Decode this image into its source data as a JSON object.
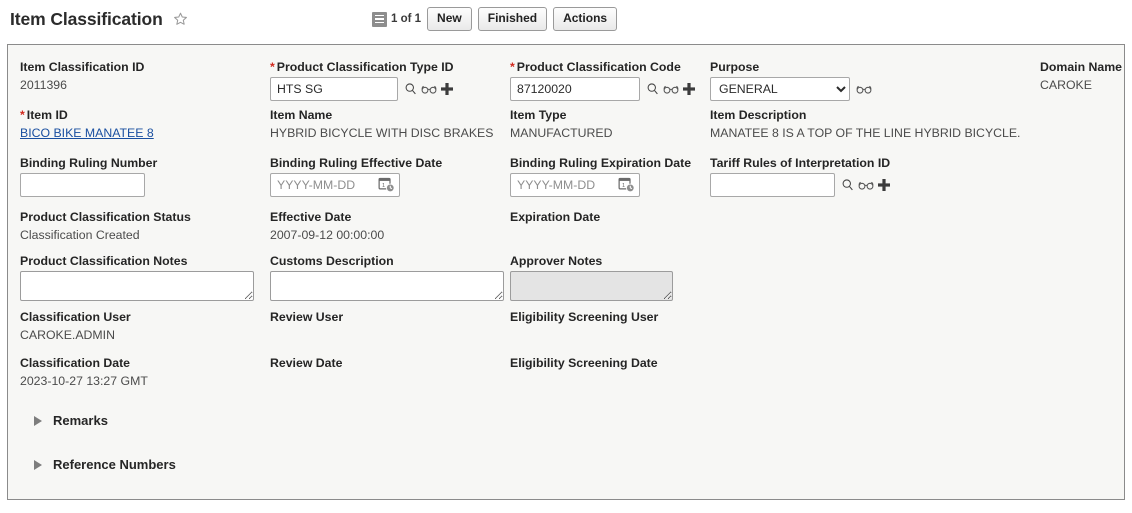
{
  "header": {
    "title": "Item Classification",
    "star_icon": "star-outline-icon",
    "list_icon": "list-view-icon",
    "page_count": "1 of 1",
    "buttons": [
      {
        "label": "New",
        "name": "new-button"
      },
      {
        "label": "Finished",
        "name": "finished-button"
      },
      {
        "label": "Actions",
        "name": "actions-button"
      }
    ]
  },
  "icons": {
    "search": "search-icon",
    "view": "glasses-view-icon",
    "add": "plus-add-icon",
    "calendar": "calendar-clock-icon",
    "chevron": "chevron-down-icon"
  },
  "form": {
    "item_classification_id": {
      "label": "Item Classification ID",
      "value": "2011396"
    },
    "product_classification_type_id": {
      "label": "Product Classification Type ID",
      "required": true,
      "value": "HTS SG"
    },
    "product_classification_code": {
      "label": "Product Classification Code",
      "required": true,
      "value": "87120020"
    },
    "purpose": {
      "label": "Purpose",
      "value": "GENERAL",
      "options": [
        "GENERAL"
      ]
    },
    "domain_name": {
      "label": "Domain Name",
      "value": "CAROKE"
    },
    "item_id": {
      "label": "Item ID",
      "required": true,
      "value": "BICO BIKE MANATEE 8"
    },
    "item_name": {
      "label": "Item Name",
      "value": "HYBRID BICYCLE WITH DISC BRAKES"
    },
    "item_type": {
      "label": "Item Type",
      "value": "MANUFACTURED"
    },
    "item_description": {
      "label": "Item Description",
      "value": "MANATEE 8 IS A TOP OF THE LINE HYBRID BICYCLE."
    },
    "binding_ruling_number": {
      "label": "Binding Ruling Number",
      "value": ""
    },
    "binding_ruling_effective_date": {
      "label": "Binding Ruling Effective Date",
      "value": "",
      "placeholder": "YYYY-MM-DD"
    },
    "binding_ruling_expiration_date": {
      "label": "Binding Ruling Expiration Date",
      "value": "",
      "placeholder": "YYYY-MM-DD"
    },
    "tariff_rules_of_interpretation_id": {
      "label": "Tariff Rules of Interpretation ID",
      "value": ""
    },
    "product_classification_status": {
      "label": "Product Classification Status",
      "value": "Classification Created"
    },
    "effective_date": {
      "label": "Effective Date",
      "value": "2007-09-12 00:00:00"
    },
    "expiration_date": {
      "label": "Expiration Date",
      "value": ""
    },
    "product_classification_notes": {
      "label": "Product Classification Notes",
      "value": ""
    },
    "customs_description": {
      "label": "Customs Description",
      "value": ""
    },
    "approver_notes": {
      "label": "Approver Notes",
      "value": "",
      "disabled": true
    },
    "classification_user": {
      "label": "Classification User",
      "value": "CAROKE.ADMIN"
    },
    "review_user": {
      "label": "Review User",
      "value": ""
    },
    "eligibility_screening_user": {
      "label": "Eligibility Screening User",
      "value": ""
    },
    "classification_date": {
      "label": "Classification Date",
      "value": "2023-10-27 13:27 GMT"
    },
    "review_date": {
      "label": "Review Date",
      "value": ""
    },
    "eligibility_screening_date": {
      "label": "Eligibility Screening Date",
      "value": ""
    }
  },
  "sections": [
    {
      "label": "Remarks",
      "name": "section-remarks"
    },
    {
      "label": "Reference Numbers",
      "name": "section-reference-numbers"
    }
  ],
  "colors": {
    "required_marker": "#d12a1e",
    "link": "#1a4fa0",
    "panel_bg": "#f7f7f5",
    "panel_border": "#8b8b8b"
  }
}
